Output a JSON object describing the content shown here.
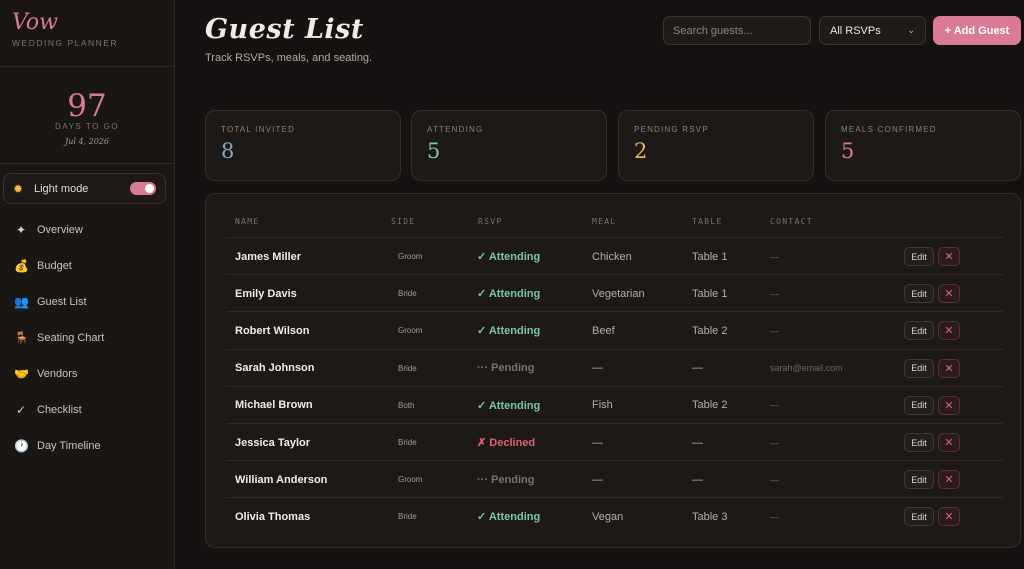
{
  "brand": {
    "name": "Vow",
    "subtitle": "WEDDING PLANNER"
  },
  "countdown": {
    "number": "97",
    "label": "DAYS TO GO",
    "date": "Jul 4, 2026"
  },
  "mode": {
    "icon": "sun-icon",
    "label": "Light mode",
    "enabled": true
  },
  "nav": [
    {
      "label": "Overview",
      "icon": "sparkle-icon",
      "glyph": "✦"
    },
    {
      "label": "Budget",
      "icon": "money-bag-icon",
      "glyph": "💰"
    },
    {
      "label": "Guest List",
      "icon": "people-icon",
      "glyph": "👥"
    },
    {
      "label": "Seating Chart",
      "icon": "chair-icon",
      "glyph": "🪑"
    },
    {
      "label": "Vendors",
      "icon": "handshake-icon",
      "glyph": "🤝"
    },
    {
      "label": "Checklist",
      "icon": "check-icon",
      "glyph": "✓"
    },
    {
      "label": "Day Timeline",
      "icon": "clock-icon",
      "glyph": "🕐"
    }
  ],
  "header": {
    "title": "Guest List",
    "subtitle": "Track RSVPs, meals, and seating.",
    "search_placeholder": "Search guests...",
    "filter_value": "All RSVPs",
    "add_label": "+ Add Guest"
  },
  "stats": [
    {
      "label": "TOTAL INVITED",
      "value": "8",
      "color": "#7fa8c9"
    },
    {
      "label": "ATTENDING",
      "value": "5",
      "color": "#7cc8a4"
    },
    {
      "label": "PENDING RSVP",
      "value": "2",
      "color": "#e6b35f"
    },
    {
      "label": "MEALS CONFIRMED",
      "value": "5",
      "color": "#d97b94"
    }
  ],
  "table": {
    "columns": [
      "NAME",
      "SIDE",
      "RSVP",
      "MEAL",
      "TABLE",
      "CONTACT"
    ],
    "edit_label": "Edit",
    "delete_label": "✕",
    "rows": [
      {
        "name": "James Miller",
        "side": "Groom",
        "rsvp": "✓ Attending",
        "status": "attending",
        "meal": "Chicken",
        "table": "Table 1",
        "contact": "—"
      },
      {
        "name": "Emily Davis",
        "side": "Bride",
        "rsvp": "✓ Attending",
        "status": "attending",
        "meal": "Vegetarian",
        "table": "Table 1",
        "contact": "—"
      },
      {
        "name": "Robert Wilson",
        "side": "Groom",
        "rsvp": "✓ Attending",
        "status": "attending",
        "meal": "Beef",
        "table": "Table 2",
        "contact": "—"
      },
      {
        "name": "Sarah Johnson",
        "side": "Bride",
        "rsvp": "··· Pending",
        "status": "pending",
        "meal": "—",
        "table": "—",
        "contact": "sarah@email.com"
      },
      {
        "name": "Michael Brown",
        "side": "Both",
        "rsvp": "✓ Attending",
        "status": "attending",
        "meal": "Fish",
        "table": "Table 2",
        "contact": "—"
      },
      {
        "name": "Jessica Taylor",
        "side": "Bride",
        "rsvp": "✗ Declined",
        "status": "declined",
        "meal": "—",
        "table": "—",
        "contact": "—"
      },
      {
        "name": "William Anderson",
        "side": "Groom",
        "rsvp": "··· Pending",
        "status": "pending",
        "meal": "—",
        "table": "—",
        "contact": "—"
      },
      {
        "name": "Olivia Thomas",
        "side": "Bride",
        "rsvp": "✓ Attending",
        "status": "attending",
        "meal": "Vegan",
        "table": "Table 3",
        "contact": "—"
      }
    ]
  },
  "status_colors": {
    "attending": "#7cc8a4",
    "pending": "#7a716c",
    "declined": "#e0606e"
  }
}
